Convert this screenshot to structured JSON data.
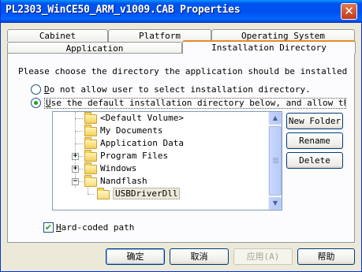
{
  "window": {
    "title": "PL2303_WinCE50_ARM_v1009.CAB Properties",
    "close_glyph": "✕"
  },
  "tabs": {
    "row1": [
      {
        "label": "Cabinet"
      },
      {
        "label": "Platform"
      },
      {
        "label": "Operating System"
      }
    ],
    "row2": [
      {
        "label": "Application"
      },
      {
        "label": "Installation Directory",
        "active": true
      }
    ]
  },
  "panel": {
    "instruction": "Please choose the directory the application should be installed",
    "radio_no_select": {
      "mnemonic": "D",
      "rest": "o not allow user to select installation directory.",
      "checked": false
    },
    "radio_default": {
      "mnemonic": "U",
      "rest": "se the default installation directory below, and allow the use",
      "checked": true
    },
    "tree": [
      {
        "label": "<Default Volume>",
        "expander": ""
      },
      {
        "label": "My Documents",
        "expander": ""
      },
      {
        "label": "Application Data",
        "expander": ""
      },
      {
        "label": "Program Files",
        "expander": "+"
      },
      {
        "label": "Windows",
        "expander": "+"
      },
      {
        "label": "Nandflash",
        "expander": "−"
      },
      {
        "label": "USBDriverDll",
        "expander": "",
        "selected": true
      }
    ],
    "side_buttons": {
      "new_folder": {
        "label": "New Folder"
      },
      "rename": {
        "label": "Rename"
      },
      "delete": {
        "label": "Delete"
      }
    },
    "hardcoded": {
      "mnemonic": "H",
      "rest": "ard-coded path",
      "checked": true,
      "check_glyph": "✔"
    }
  },
  "footer": {
    "ok": "确定",
    "cancel": "取消",
    "apply": "应用(A)",
    "help": "帮助"
  },
  "colors": {
    "titlebar": "#0054e3",
    "dialog_bg": "#ece9d8",
    "active_tab_accent": "#e68b2c",
    "radio_dot": "#21a121"
  }
}
